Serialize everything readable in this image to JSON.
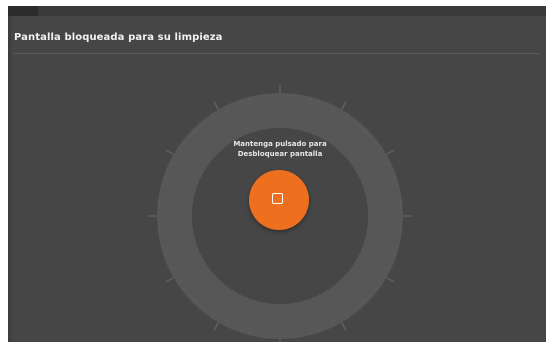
{
  "screen": {
    "title": "Pantalla bloqueada para su limpieza"
  },
  "lock": {
    "prompt_line1": "Mantenga pulsado para",
    "prompt_line2": "Desbloquear pantalla",
    "button_icon": "stop-square-icon"
  },
  "colors": {
    "background": "#464646",
    "accent": "#ee6f1d",
    "ring": "#575757",
    "text": "#f2f2f2"
  }
}
